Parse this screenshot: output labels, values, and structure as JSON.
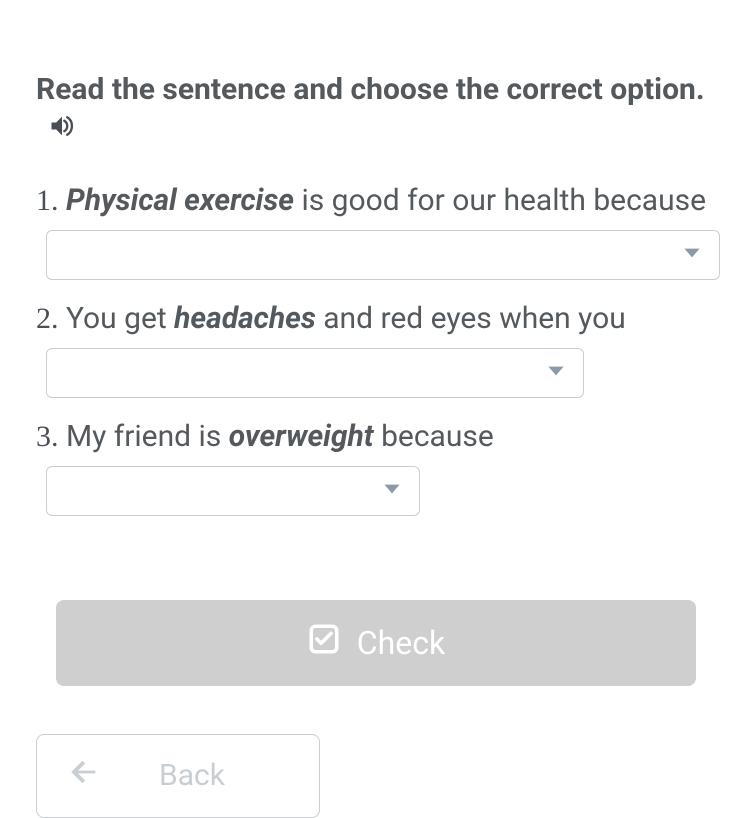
{
  "instruction": "Read the sentence and choose the correct option.",
  "questions": [
    {
      "num": "1.",
      "t1": "Physical exercise",
      "t2": " is good for our health because"
    },
    {
      "num": "2.",
      "t0": " You get ",
      "t1": "headaches",
      "t2": " and red eyes when you"
    },
    {
      "num": "3.",
      "t0": " My friend is ",
      "t1": "overweight",
      "t2": " because"
    }
  ],
  "buttons": {
    "check": "Check",
    "back": "Back"
  }
}
